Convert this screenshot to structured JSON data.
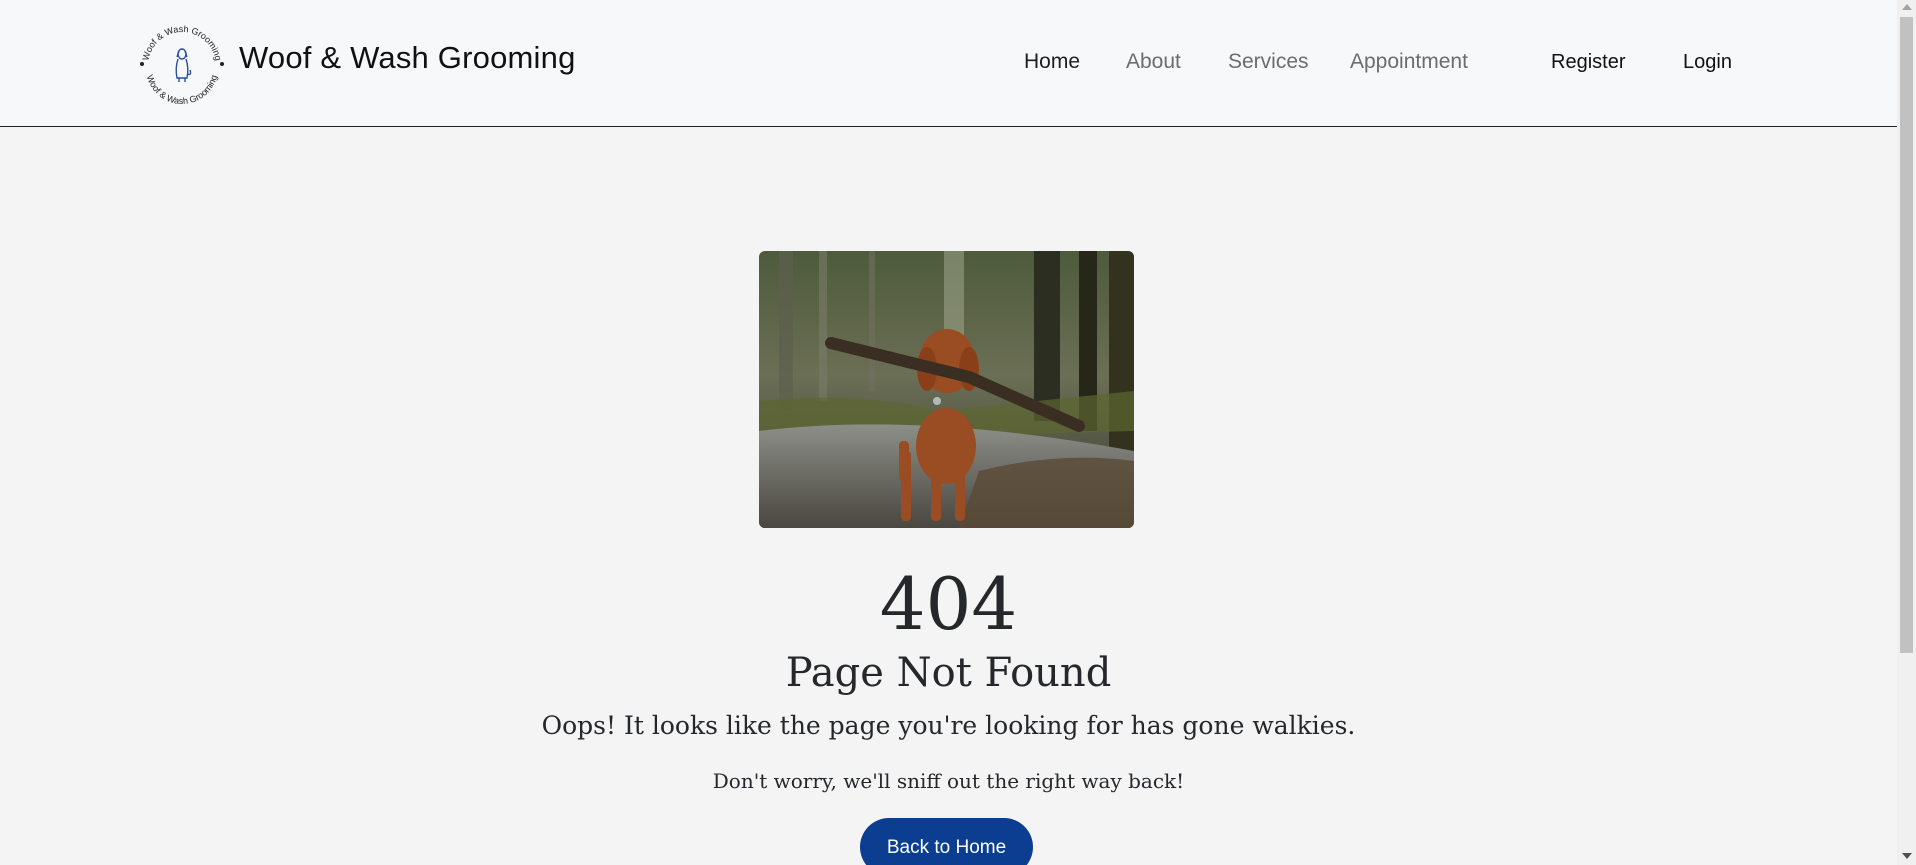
{
  "brand": {
    "name": "Woof & Wash Grooming",
    "logo_ring_text": "Woof & Wash Grooming"
  },
  "nav": {
    "links": [
      {
        "label": "Home",
        "active": true
      },
      {
        "label": "About",
        "active": false
      },
      {
        "label": "Services",
        "active": false
      },
      {
        "label": "Appointment",
        "active": false
      }
    ],
    "register": "Register",
    "login": "Login"
  },
  "error": {
    "code": "404",
    "title": "Page Not Found",
    "message": "Oops! It looks like the page you're looking for has gone walkies.",
    "submessage": "Don't worry, we'll sniff out the right way back!",
    "button": "Back to Home"
  },
  "colors": {
    "button_bg": "#0b3d91",
    "page_bg": "#f4f4f4",
    "nav_bg": "#f7f8fa"
  }
}
